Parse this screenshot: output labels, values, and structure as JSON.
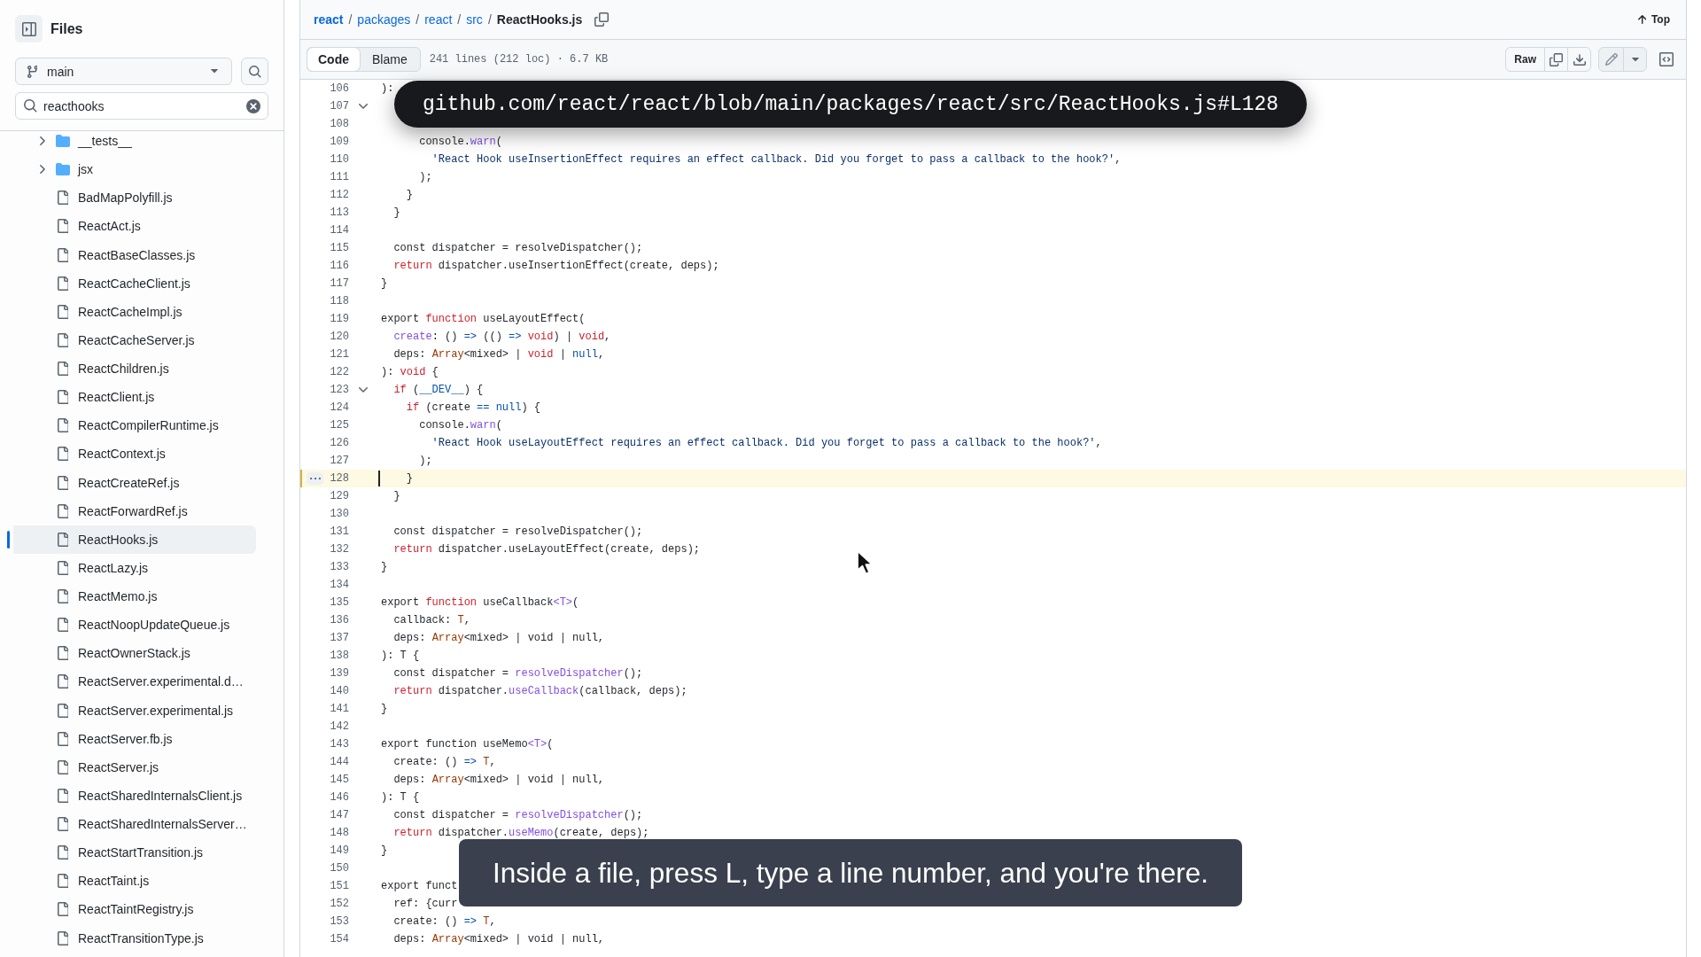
{
  "sidebar": {
    "title": "Files",
    "branch": "main",
    "filter": {
      "value": "reacthooks"
    },
    "tree": [
      {
        "name": "__tests__",
        "kind": "folder",
        "expanded": false,
        "selected": false
      },
      {
        "name": "jsx",
        "kind": "folder",
        "expanded": false,
        "selected": false
      },
      {
        "name": "BadMapPolyfill.js",
        "kind": "file",
        "selected": false
      },
      {
        "name": "ReactAct.js",
        "kind": "file",
        "selected": false
      },
      {
        "name": "ReactBaseClasses.js",
        "kind": "file",
        "selected": false
      },
      {
        "name": "ReactCacheClient.js",
        "kind": "file",
        "selected": false
      },
      {
        "name": "ReactCacheImpl.js",
        "kind": "file",
        "selected": false
      },
      {
        "name": "ReactCacheServer.js",
        "kind": "file",
        "selected": false
      },
      {
        "name": "ReactChildren.js",
        "kind": "file",
        "selected": false
      },
      {
        "name": "ReactClient.js",
        "kind": "file",
        "selected": false
      },
      {
        "name": "ReactCompilerRuntime.js",
        "kind": "file",
        "selected": false
      },
      {
        "name": "ReactContext.js",
        "kind": "file",
        "selected": false
      },
      {
        "name": "ReactCreateRef.js",
        "kind": "file",
        "selected": false
      },
      {
        "name": "ReactForwardRef.js",
        "kind": "file",
        "selected": false
      },
      {
        "name": "ReactHooks.js",
        "kind": "file",
        "selected": true
      },
      {
        "name": "ReactLazy.js",
        "kind": "file",
        "selected": false
      },
      {
        "name": "ReactMemo.js",
        "kind": "file",
        "selected": false
      },
      {
        "name": "ReactNoopUpdateQueue.js",
        "kind": "file",
        "selected": false
      },
      {
        "name": "ReactOwnerStack.js",
        "kind": "file",
        "selected": false
      },
      {
        "name": "ReactServer.experimental.d…",
        "kind": "file",
        "selected": false
      },
      {
        "name": "ReactServer.experimental.js",
        "kind": "file",
        "selected": false
      },
      {
        "name": "ReactServer.fb.js",
        "kind": "file",
        "selected": false
      },
      {
        "name": "ReactServer.js",
        "kind": "file",
        "selected": false
      },
      {
        "name": "ReactSharedInternalsClient.js",
        "kind": "file",
        "selected": false
      },
      {
        "name": "ReactSharedInternalsServer…",
        "kind": "file",
        "selected": false
      },
      {
        "name": "ReactStartTransition.js",
        "kind": "file",
        "selected": false
      },
      {
        "name": "ReactTaint.js",
        "kind": "file",
        "selected": false
      },
      {
        "name": "ReactTaintRegistry.js",
        "kind": "file",
        "selected": false
      },
      {
        "name": "ReactTransitionType.js",
        "kind": "file",
        "selected": false
      }
    ]
  },
  "breadcrumb": [
    {
      "kind": "repo",
      "text": "react"
    },
    {
      "kind": "separator",
      "text": "/"
    },
    {
      "kind": "link",
      "text": "packages"
    },
    {
      "kind": "separator",
      "text": "/"
    },
    {
      "kind": "link",
      "text": "react"
    },
    {
      "kind": "separator",
      "text": "/"
    },
    {
      "kind": "link",
      "text": "src"
    },
    {
      "kind": "separator",
      "text": "/"
    },
    {
      "kind": "file",
      "text": "ReactHooks.js"
    }
  ],
  "top_button": "Top",
  "tabs": [
    {
      "label": "Code",
      "selected": true
    },
    {
      "label": "Blame",
      "selected": false
    }
  ],
  "file_info": "241 lines (212 loc) · 6.7 KB",
  "raw_button": "Raw",
  "code": {
    "lines": [
      {
        "number": "106",
        "fold": false,
        "selected": false,
        "tokens": [
          {
            "kind": "plain",
            "text": "):"
          }
        ]
      },
      {
        "number": "107",
        "fold": true,
        "selected": false
      },
      {
        "number": "108",
        "fold": false,
        "selected": false
      },
      {
        "number": "109",
        "fold": false,
        "selected": false,
        "tokens": [
          {
            "kind": "plain",
            "text": "      console."
          },
          {
            "kind": "entity",
            "text": "warn"
          },
          {
            "kind": "plain",
            "text": "("
          }
        ]
      },
      {
        "number": "110",
        "fold": false,
        "selected": false,
        "tokens": [
          {
            "kind": "string",
            "text": "        'React Hook useInsertionEffect requires an effect callback. Did you forget to pass a callback to the hook?'"
          },
          {
            "kind": "plain",
            "text": ","
          }
        ]
      },
      {
        "number": "111",
        "fold": false,
        "selected": false,
        "tokens": [
          {
            "kind": "plain",
            "text": "      );"
          }
        ]
      },
      {
        "number": "112",
        "fold": false,
        "selected": false,
        "tokens": [
          {
            "kind": "plain",
            "text": "    }"
          }
        ]
      },
      {
        "number": "113",
        "fold": false,
        "selected": false,
        "tokens": [
          {
            "kind": "plain",
            "text": "  }"
          }
        ]
      },
      {
        "number": "114",
        "fold": false,
        "selected": false
      },
      {
        "number": "115",
        "fold": false,
        "selected": false,
        "tokens": [
          {
            "kind": "plain",
            "text": "  const dispatcher = resolveDispatcher();"
          }
        ]
      },
      {
        "number": "116",
        "fold": false,
        "selected": false,
        "tokens": [
          {
            "kind": "keyword",
            "text": "  return"
          },
          {
            "kind": "plain",
            "text": " dispatcher.useInsertionEffect(create, deps);"
          }
        ]
      },
      {
        "number": "117",
        "fold": false,
        "selected": false,
        "tokens": [
          {
            "kind": "plain",
            "text": "}"
          }
        ]
      },
      {
        "number": "118",
        "fold": false,
        "selected": false
      },
      {
        "number": "119",
        "fold": false,
        "selected": false,
        "tokens": [
          {
            "kind": "plain",
            "text": "export "
          },
          {
            "kind": "keyword",
            "text": "function"
          },
          {
            "kind": "plain",
            "text": " useLayoutEffect("
          }
        ]
      },
      {
        "number": "120",
        "fold": false,
        "selected": false,
        "tokens": [
          {
            "kind": "entity",
            "text": "  create"
          },
          {
            "kind": "plain",
            "text": ": () "
          },
          {
            "kind": "constant",
            "text": "=>"
          },
          {
            "kind": "plain",
            "text": " (() "
          },
          {
            "kind": "constant",
            "text": "=>"
          },
          {
            "kind": "keyword",
            "text": " void"
          },
          {
            "kind": "plain",
            "text": ") | "
          },
          {
            "kind": "keyword",
            "text": "void"
          },
          {
            "kind": "plain",
            "text": ","
          }
        ]
      },
      {
        "number": "121",
        "fold": false,
        "selected": false,
        "tokens": [
          {
            "kind": "plain",
            "text": "  deps: "
          },
          {
            "kind": "type",
            "text": "Array"
          },
          {
            "kind": "plain",
            "text": "<mixed> | "
          },
          {
            "kind": "keyword",
            "text": "void"
          },
          {
            "kind": "plain",
            "text": " | "
          },
          {
            "kind": "constant",
            "text": "null"
          },
          {
            "kind": "plain",
            "text": ","
          }
        ]
      },
      {
        "number": "122",
        "fold": false,
        "selected": false,
        "tokens": [
          {
            "kind": "plain",
            "text": "): "
          },
          {
            "kind": "keyword",
            "text": "void"
          },
          {
            "kind": "plain",
            "text": " {"
          }
        ]
      },
      {
        "number": "123",
        "fold": true,
        "selected": false,
        "tokens": [
          {
            "kind": "keyword",
            "text": "  if"
          },
          {
            "kind": "plain",
            "text": " ("
          },
          {
            "kind": "constant",
            "text": "__DEV__"
          },
          {
            "kind": "plain",
            "text": ") {"
          }
        ]
      },
      {
        "number": "124",
        "fold": false,
        "selected": false,
        "tokens": [
          {
            "kind": "keyword",
            "text": "    if"
          },
          {
            "kind": "plain",
            "text": " (create "
          },
          {
            "kind": "constant",
            "text": "=="
          },
          {
            "kind": "constant",
            "text": " null"
          },
          {
            "kind": "plain",
            "text": ") {"
          }
        ]
      },
      {
        "number": "125",
        "fold": false,
        "selected": false,
        "tokens": [
          {
            "kind": "plain",
            "text": "      console."
          },
          {
            "kind": "entity",
            "text": "warn"
          },
          {
            "kind": "plain",
            "text": "("
          }
        ]
      },
      {
        "number": "126",
        "fold": false,
        "selected": false,
        "tokens": [
          {
            "kind": "string",
            "text": "        'React Hook useLayoutEffect requires an effect callback. Did you forget to pass a callback to the hook?'"
          },
          {
            "kind": "plain",
            "text": ","
          }
        ]
      },
      {
        "number": "127",
        "fold": false,
        "selected": false,
        "tokens": [
          {
            "kind": "plain",
            "text": "      );"
          }
        ]
      },
      {
        "number": "128",
        "fold": false,
        "selected": true,
        "tokens": [
          {
            "kind": "plain",
            "text": "    }"
          }
        ]
      },
      {
        "number": "129",
        "fold": false,
        "selected": false,
        "tokens": [
          {
            "kind": "plain",
            "text": "  }"
          }
        ]
      },
      {
        "number": "130",
        "fold": false,
        "selected": false
      },
      {
        "number": "131",
        "fold": false,
        "selected": false,
        "tokens": [
          {
            "kind": "plain",
            "text": "  const dispatcher = resolveDispatcher();"
          }
        ]
      },
      {
        "number": "132",
        "fold": false,
        "selected": false,
        "tokens": [
          {
            "kind": "keyword",
            "text": "  return"
          },
          {
            "kind": "plain",
            "text": " dispatcher.useLayoutEffect(create, deps);"
          }
        ]
      },
      {
        "number": "133",
        "fold": false,
        "selected": false,
        "tokens": [
          {
            "kind": "plain",
            "text": "}"
          }
        ]
      },
      {
        "number": "134",
        "fold": false,
        "selected": false
      },
      {
        "number": "135",
        "fold": false,
        "selected": false,
        "tokens": [
          {
            "kind": "plain",
            "text": "export "
          },
          {
            "kind": "keyword",
            "text": "function"
          },
          {
            "kind": "plain",
            "text": " useCallback"
          },
          {
            "kind": "entity",
            "text": "<T>"
          },
          {
            "kind": "plain",
            "text": "("
          }
        ]
      },
      {
        "number": "136",
        "fold": false,
        "selected": false,
        "tokens": [
          {
            "kind": "plain",
            "text": "  callback: "
          },
          {
            "kind": "type",
            "text": "T"
          },
          {
            "kind": "plain",
            "text": ","
          }
        ]
      },
      {
        "number": "137",
        "fold": false,
        "selected": false,
        "tokens": [
          {
            "kind": "plain",
            "text": "  deps: "
          },
          {
            "kind": "type",
            "text": "Array"
          },
          {
            "kind": "plain",
            "text": "<mixed> | void | null,"
          }
        ]
      },
      {
        "number": "138",
        "fold": false,
        "selected": false,
        "tokens": [
          {
            "kind": "plain",
            "text": "): T {"
          }
        ]
      },
      {
        "number": "139",
        "fold": false,
        "selected": false,
        "tokens": [
          {
            "kind": "plain",
            "text": "  const dispatcher = "
          },
          {
            "kind": "entity",
            "text": "resolveDispatcher"
          },
          {
            "kind": "plain",
            "text": "();"
          }
        ]
      },
      {
        "number": "140",
        "fold": false,
        "selected": false,
        "tokens": [
          {
            "kind": "keyword",
            "text": "  return"
          },
          {
            "kind": "plain",
            "text": " dispatcher."
          },
          {
            "kind": "entity",
            "text": "useCallback"
          },
          {
            "kind": "plain",
            "text": "(callback, deps);"
          }
        ]
      },
      {
        "number": "141",
        "fold": false,
        "selected": false,
        "tokens": [
          {
            "kind": "plain",
            "text": "}"
          }
        ]
      },
      {
        "number": "142",
        "fold": false,
        "selected": false
      },
      {
        "number": "143",
        "fold": false,
        "selected": false,
        "tokens": [
          {
            "kind": "plain",
            "text": "export function useMemo"
          },
          {
            "kind": "entity",
            "text": "<T>"
          },
          {
            "kind": "plain",
            "text": "("
          }
        ]
      },
      {
        "number": "144",
        "fold": false,
        "selected": false,
        "tokens": [
          {
            "kind": "plain",
            "text": "  create: () "
          },
          {
            "kind": "constant",
            "text": "=>"
          },
          {
            "kind": "type",
            "text": " T"
          },
          {
            "kind": "plain",
            "text": ","
          }
        ]
      },
      {
        "number": "145",
        "fold": false,
        "selected": false,
        "tokens": [
          {
            "kind": "plain",
            "text": "  deps: "
          },
          {
            "kind": "type",
            "text": "Array"
          },
          {
            "kind": "plain",
            "text": "<mixed> | void | null,"
          }
        ]
      },
      {
        "number": "146",
        "fold": false,
        "selected": false,
        "tokens": [
          {
            "kind": "plain",
            "text": "): T {"
          }
        ]
      },
      {
        "number": "147",
        "fold": false,
        "selected": false,
        "tokens": [
          {
            "kind": "plain",
            "text": "  const dispatcher = "
          },
          {
            "kind": "entity",
            "text": "resolveDispatcher"
          },
          {
            "kind": "plain",
            "text": "();"
          }
        ]
      },
      {
        "number": "148",
        "fold": false,
        "selected": false,
        "tokens": [
          {
            "kind": "keyword",
            "text": "  return"
          },
          {
            "kind": "plain",
            "text": " dispatcher."
          },
          {
            "kind": "entity",
            "text": "useMemo"
          },
          {
            "kind": "plain",
            "text": "(create, deps);"
          }
        ]
      },
      {
        "number": "149",
        "fold": false,
        "selected": false,
        "tokens": [
          {
            "kind": "plain",
            "text": "}"
          }
        ]
      },
      {
        "number": "150",
        "fold": false,
        "selected": false
      },
      {
        "number": "151",
        "fold": false,
        "selected": false,
        "tokens": [
          {
            "kind": "plain",
            "text": "export funct"
          }
        ]
      },
      {
        "number": "152",
        "fold": false,
        "selected": false,
        "tokens": [
          {
            "kind": "plain",
            "text": "  ref: {curr"
          }
        ]
      },
      {
        "number": "153",
        "fold": false,
        "selected": false,
        "tokens": [
          {
            "kind": "plain",
            "text": "  create: () "
          },
          {
            "kind": "constant",
            "text": "=>"
          },
          {
            "kind": "type",
            "text": " T"
          },
          {
            "kind": "plain",
            "text": ","
          }
        ]
      },
      {
        "number": "154",
        "fold": false,
        "selected": false,
        "tokens": [
          {
            "kind": "plain",
            "text": "  deps: "
          },
          {
            "kind": "type",
            "text": "Array"
          },
          {
            "kind": "plain",
            "text": "<mixed> | void | null,"
          }
        ]
      }
    ]
  },
  "url_banner": "github.com/react/react/blob/main/packages/react/src/ReactHooks.js#L128",
  "caption": "Inside a file, press L, type a line number, and you're there."
}
